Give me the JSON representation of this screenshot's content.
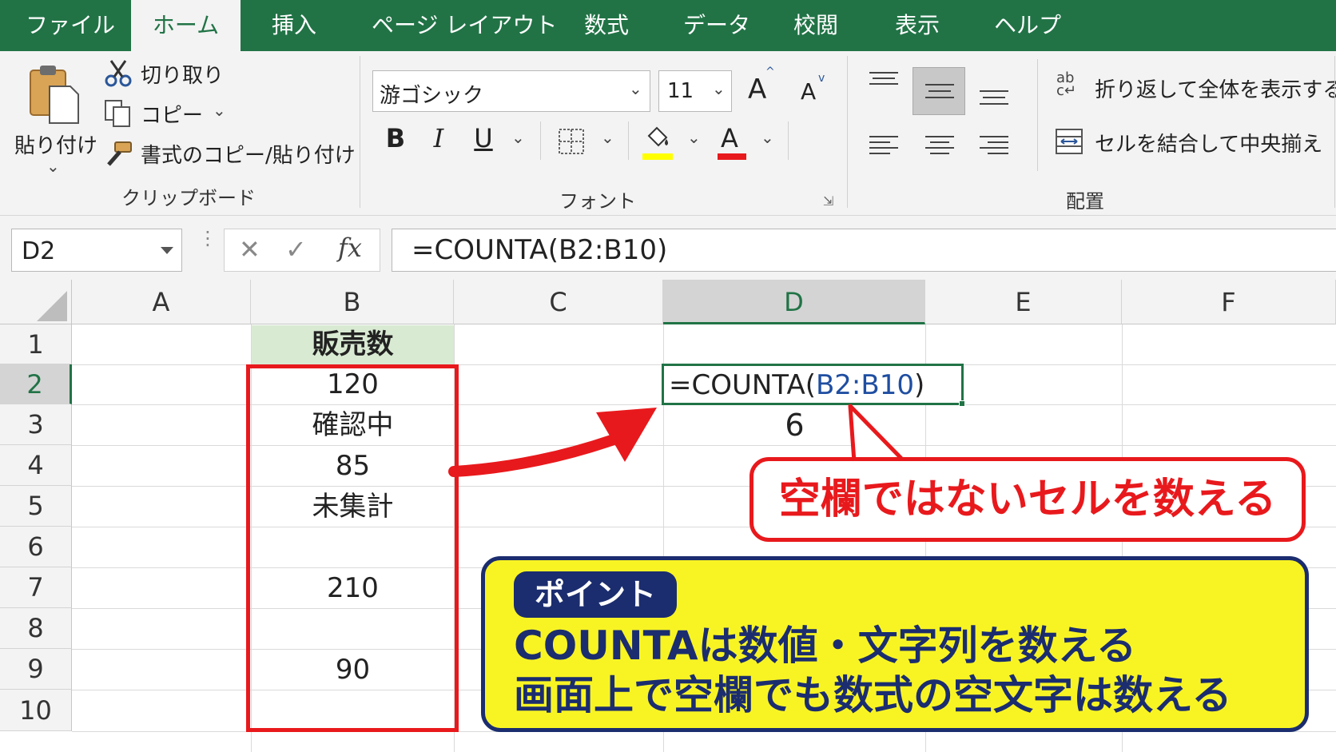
{
  "colors": {
    "excel_green": "#217346",
    "accent_red": "#e8191c",
    "navy": "#1b2d6e",
    "callout_yellow": "#f8f424",
    "header_green": "#d9ead3",
    "ref_blue": "#1f4ea1"
  },
  "tabs": [
    "ファイル",
    "ホーム",
    "挿入",
    "ページ レイアウト",
    "数式",
    "データ",
    "校閲",
    "表示",
    "ヘルプ"
  ],
  "clipboard": {
    "paste": "貼り付け",
    "cut": "切り取り",
    "copy": "コピー",
    "format_painter": "書式のコピー/貼り付け",
    "group": "クリップボード"
  },
  "font": {
    "name": "游ゴシック",
    "size": "11",
    "bold": "B",
    "italic": "I",
    "underline": "U",
    "font_color_glyph": "A",
    "grow": "A",
    "shrink": "A",
    "group": "フォント"
  },
  "alignment": {
    "wrap": "折り返して全体を表示する",
    "merge": "セルを結合して中央揃え",
    "group": "配置"
  },
  "formula_bar": {
    "name_box": "D2",
    "formula": "=COUNTA(B2:B10)",
    "fx": "fx"
  },
  "columns": [
    "A",
    "B",
    "C",
    "D",
    "E",
    "F"
  ],
  "rows": [
    "1",
    "2",
    "3",
    "4",
    "5",
    "6",
    "7",
    "8",
    "9",
    "10"
  ],
  "cells": {
    "B1": "販売数",
    "B2": "120",
    "B3": "確認中",
    "B4": "85",
    "B5": "未集計",
    "B7": "210",
    "B9": "90",
    "D3": "6"
  },
  "d2": {
    "prefix": "=COUNTA(",
    "ref": "B2:B10",
    "suffix": ")"
  },
  "callout1": "空欄ではないセルを数える",
  "point": {
    "badge": "ポイント",
    "line1": "COUNTAは数値・文字列を数える",
    "line2": "画面上で空欄でも数式の空文字は数える"
  }
}
